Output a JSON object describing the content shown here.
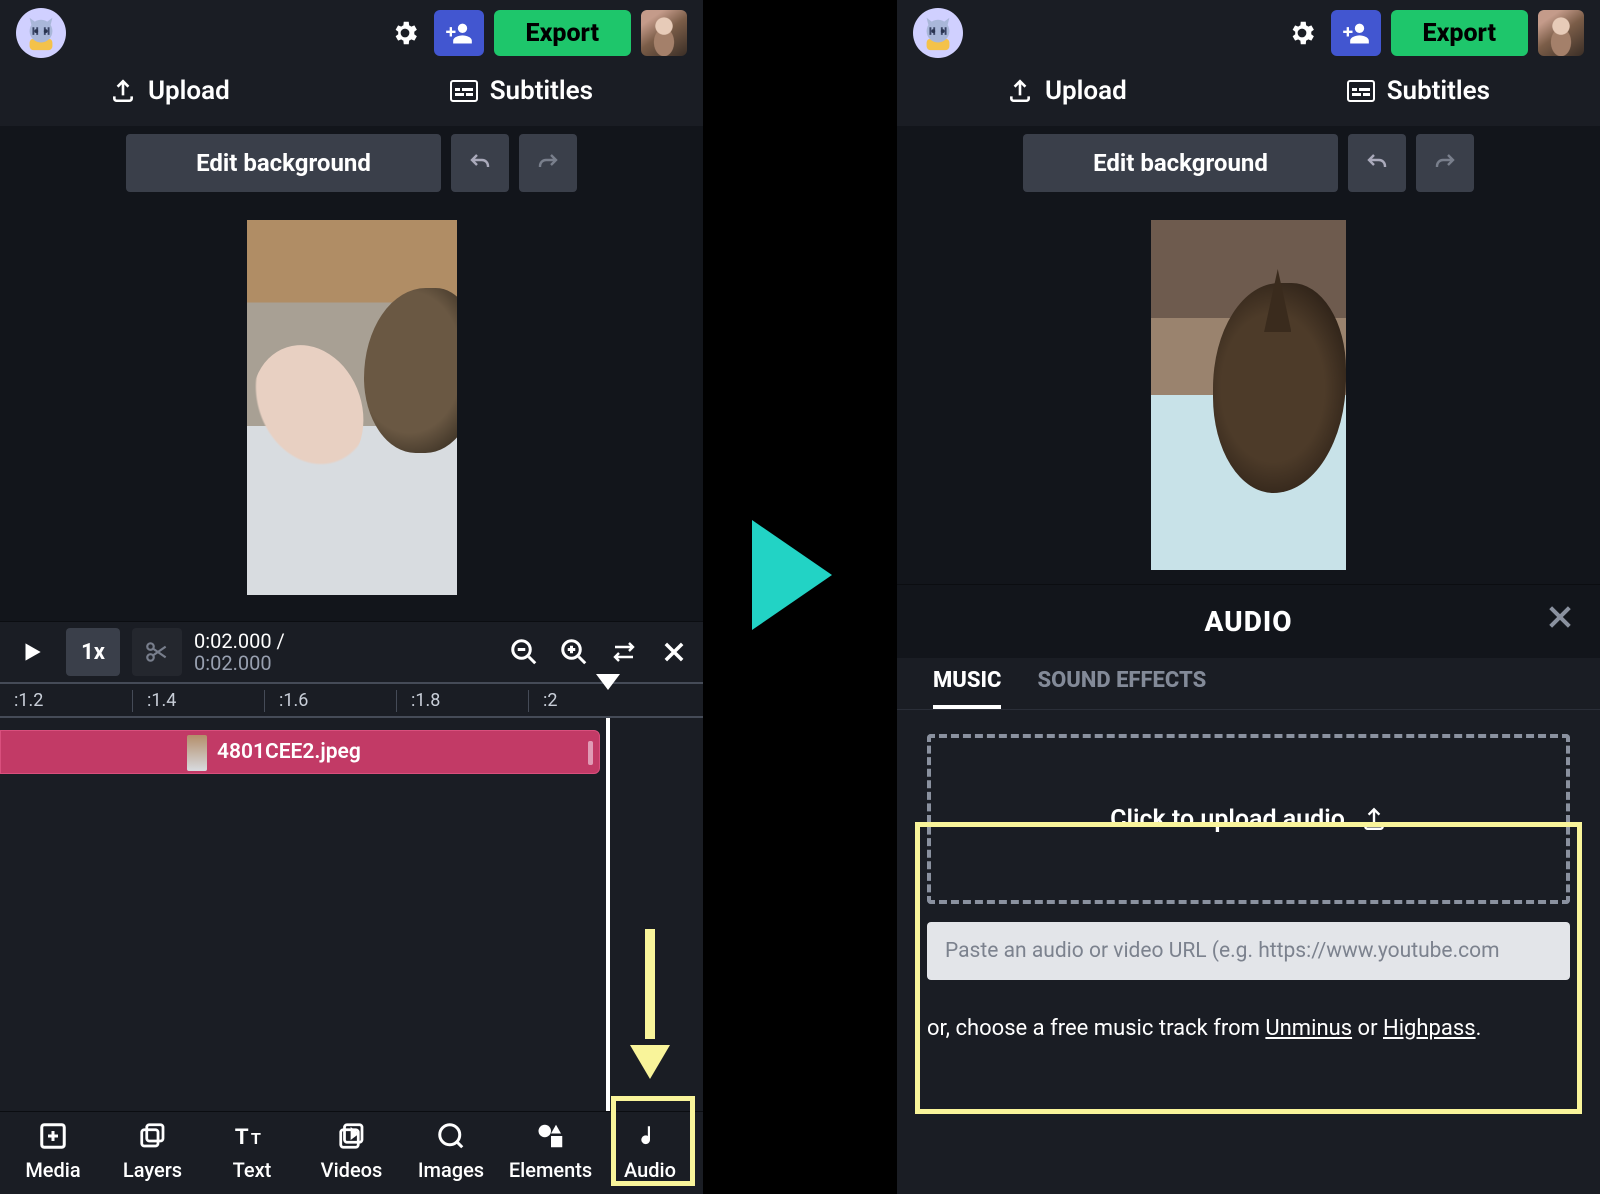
{
  "topbar": {
    "export_label": "Export"
  },
  "nav": {
    "upload_label": "Upload",
    "subtitles_label": "Subtitles"
  },
  "editbar": {
    "edit_background_label": "Edit background"
  },
  "controls": {
    "speed_label": "1x",
    "time_current": "0:02.000",
    "time_total": "0:02.000"
  },
  "ruler": {
    "ticks": [
      ":1.2",
      ":1.4",
      ":1.6",
      ":1.8",
      ":2"
    ]
  },
  "clip": {
    "filename": "4801CEE2.jpeg"
  },
  "tabs": [
    {
      "key": "media",
      "label": "Media"
    },
    {
      "key": "layers",
      "label": "Layers"
    },
    {
      "key": "text",
      "label": "Text"
    },
    {
      "key": "videos",
      "label": "Videos"
    },
    {
      "key": "images",
      "label": "Images"
    },
    {
      "key": "elements",
      "label": "Elements"
    },
    {
      "key": "audio",
      "label": "Audio"
    }
  ],
  "audio_panel": {
    "title": "AUDIO",
    "tab_music": "MUSIC",
    "tab_sfx": "SOUND EFFECTS",
    "dropzone_label": "Click to upload audio",
    "url_placeholder": "Paste an audio or video URL (e.g. https://www.youtube.com",
    "free_track_prefix": "or, choose a free music track from ",
    "provider1": "Unminus",
    "provider_sep": " or ",
    "provider2": "Highpass",
    "provider_suffix": "."
  }
}
